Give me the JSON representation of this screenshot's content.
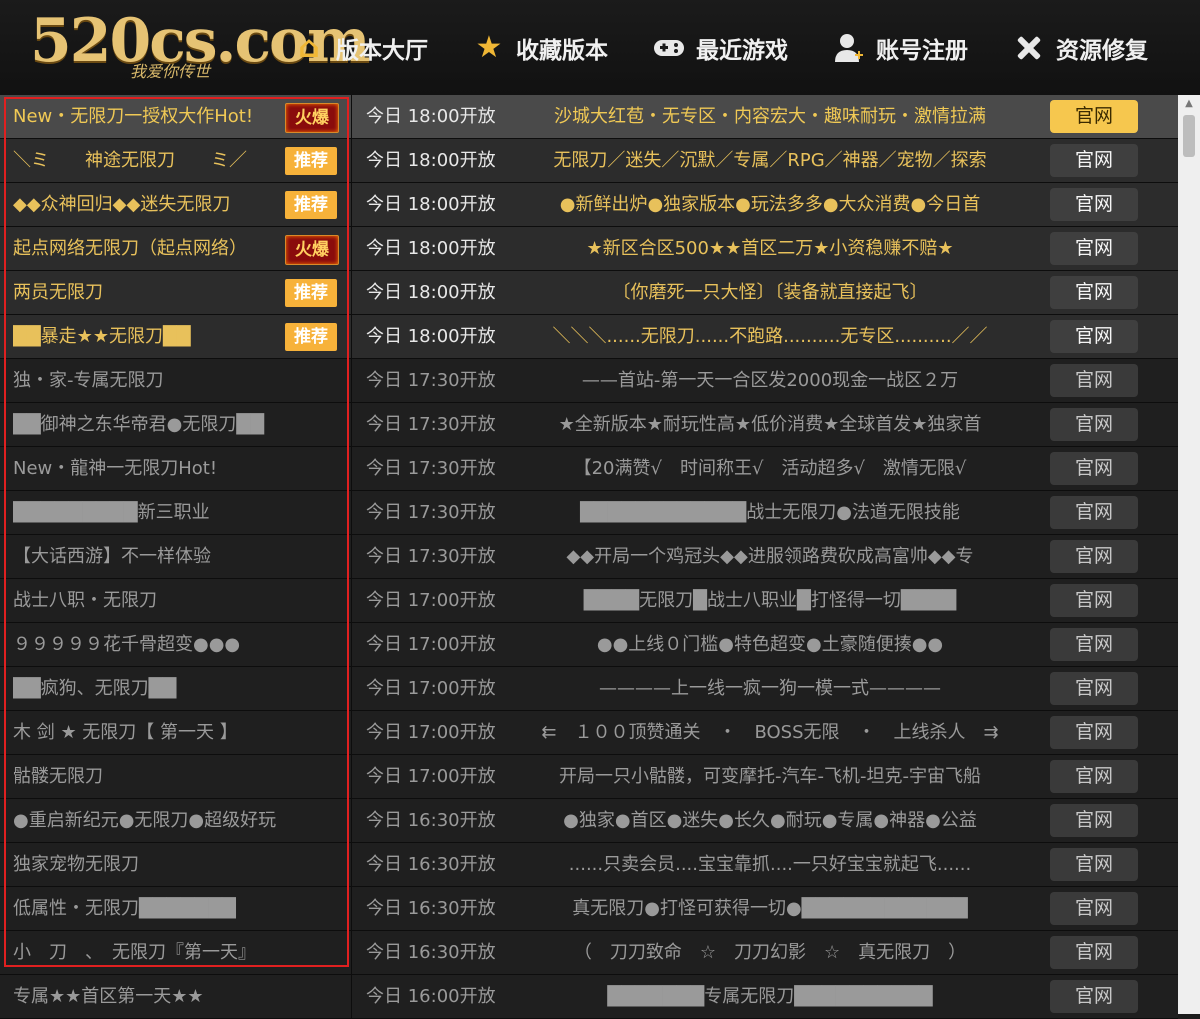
{
  "header": {
    "logo_main": "520cs.com",
    "logo_sub": "我爱你传世",
    "nav": [
      {
        "label": "版本大厅",
        "icon": "home-icon"
      },
      {
        "label": "收藏版本",
        "icon": "star-icon"
      },
      {
        "label": "最近游戏",
        "icon": "gamepad-icon"
      },
      {
        "label": "账号注册",
        "icon": "user-add-icon"
      },
      {
        "label": "资源修复",
        "icon": "tools-icon"
      }
    ]
  },
  "rows": [
    {
      "name": "New・无限刀一授权大作Hot!",
      "badge": "火爆",
      "time": "今日 18:00开放",
      "desc": "沙城大红苞・无专区・内容宏大・趣味耐玩・激情拉满",
      "btn": "官网"
    },
    {
      "name": "＼ミ　　神途无限刀　　ミ／",
      "badge": "推荐",
      "time": "今日 18:00开放",
      "desc": "无限刀／迷失／沉默／专属／RPG／神器／宠物／探索",
      "btn": "官网"
    },
    {
      "name": "◆◆众神回归◆◆迷失无限刀",
      "badge": "推荐",
      "time": "今日 18:00开放",
      "desc": "●新鲜出炉●独家版本●玩法多多●大众消费●今日首",
      "btn": "官网"
    },
    {
      "name": "起点网络无限刀（起点网络）",
      "badge": "火爆",
      "time": "今日 18:00开放",
      "desc": "★新区合区500★★首区二万★小资稳赚不赔★",
      "btn": "官网"
    },
    {
      "name": "两员无限刀",
      "badge": "推荐",
      "time": "今日 18:00开放",
      "desc": "〔你磨死一只大怪〕〔装备就直接起飞〕",
      "btn": "官网"
    },
    {
      "name": "██暴走★★无限刀██",
      "badge": "推荐",
      "time": "今日 18:00开放",
      "desc": "＼＼＼......无限刀......不跑路..........无专区..........／／",
      "btn": "官网"
    },
    {
      "name": "独・家-专属无限刀",
      "badge": "",
      "time": "今日 17:30开放",
      "desc": "——首站-第一天一合区发2000现金一战区２万",
      "btn": "官网"
    },
    {
      "name": "██御神之东华帝君●无限刀██",
      "badge": "",
      "time": "今日 17:30开放",
      "desc": "★全新版本★耐玩性高★低价消费★全球首发★独家首",
      "btn": "官网"
    },
    {
      "name": "New・龍神一无限刀Hot!",
      "badge": "",
      "time": "今日 17:30开放",
      "desc": "【20满赞√　时间称王√　活动超多√　激情无限√",
      "btn": "官网"
    },
    {
      "name": "█████████新三职业",
      "badge": "",
      "time": "今日 17:30开放",
      "desc": "████████████战士无限刀●法道无限技能",
      "btn": "官网"
    },
    {
      "name": "【大话西游】不一样体验",
      "badge": "",
      "time": "今日 17:30开放",
      "desc": "◆◆开局一个鸡冠头◆◆进服领路费砍成高富帅◆◆专",
      "btn": "官网"
    },
    {
      "name": "战士八职・无限刀",
      "badge": "",
      "time": "今日 17:00开放",
      "desc": "████无限刀█战士八职业█打怪得一切████",
      "btn": "官网"
    },
    {
      "name": "９９９９９花千骨超变●●●",
      "badge": "",
      "time": "今日 17:00开放",
      "desc": "●●上线０门槛●特色超变●土豪随便揍●●",
      "btn": "官网"
    },
    {
      "name": "██疯狗、无限刀██",
      "badge": "",
      "time": "今日 17:00开放",
      "desc": "————上一线一疯一狗一模一式————",
      "btn": "官网"
    },
    {
      "name": "木 剑 ★ 无限刀【 第一天 】",
      "badge": "",
      "time": "今日 17:00开放",
      "desc": "⇇　１００顶赞通关　・　BOSS无限　・　上线杀人　⇉",
      "btn": "官网"
    },
    {
      "name": "骷髅无限刀",
      "badge": "",
      "time": "今日 17:00开放",
      "desc": "开局一只小骷髅，可变摩托-汽车-飞机-坦克-宇宙飞船",
      "btn": "官网"
    },
    {
      "name": "●重启新纪元●无限刀●超级好玩",
      "badge": "",
      "time": "今日 16:30开放",
      "desc": "●独家●首区●迷失●长久●耐玩●专属●神器●公益",
      "btn": "官网"
    },
    {
      "name": "独家宠物无限刀",
      "badge": "",
      "time": "今日 16:30开放",
      "desc": "......只卖会员....宝宝靠抓....一只好宝宝就起飞......",
      "btn": "官网"
    },
    {
      "name": "低属性・无限刀███████",
      "badge": "",
      "time": "今日 16:30开放",
      "desc": "真无限刀●打怪可获得一切●████████████",
      "btn": "官网"
    },
    {
      "name": "小　刀　、　无限刀『第一天』",
      "badge": "",
      "time": "今日 16:30开放",
      "desc": "（　刀刀致命　☆　刀刀幻影　☆　真无限刀　）",
      "btn": "官网"
    },
    {
      "name": "专属★★首区第一天★★",
      "badge": "",
      "time": "今日 16:00开放",
      "desc": "███████专属无限刀██████████",
      "btn": "官网"
    }
  ]
}
